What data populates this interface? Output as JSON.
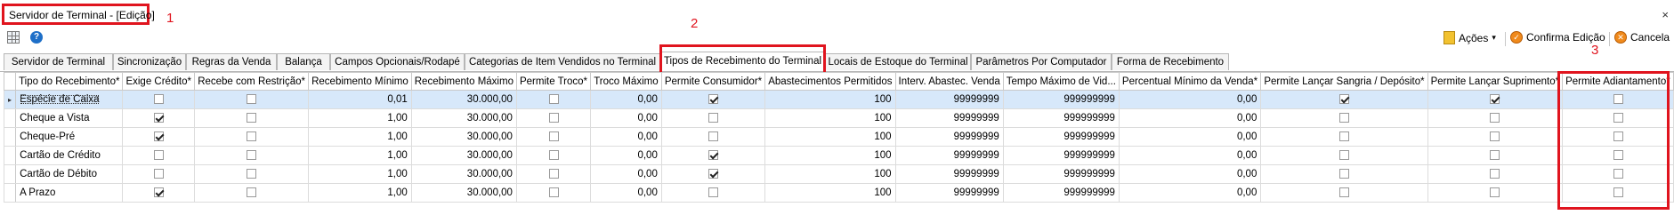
{
  "window": {
    "title": "Servidor de Terminal - [Edição]",
    "close": "×"
  },
  "annotations": [
    "1",
    "2",
    "3"
  ],
  "toolbar": {
    "acoes_label": "Ações",
    "acoes_arrow": "▾",
    "confirm_label": "Confirma Edição",
    "cancel_label": "Cancela",
    "help_glyph": "?"
  },
  "tabs": [
    {
      "label": "Servidor de Terminal"
    },
    {
      "label": "Sincronização"
    },
    {
      "label": "Regras da Venda"
    },
    {
      "label": "Balança"
    },
    {
      "label": "Campos Opcionais/Rodapé"
    },
    {
      "label": "Categorias de Item Vendidos no Terminal"
    },
    {
      "label": "Tipos de Recebimento do Terminal"
    },
    {
      "label": "Locais de Estoque do Terminal"
    },
    {
      "label": "Parâmetros Por Computador"
    },
    {
      "label": "Forma de Recebimento"
    }
  ],
  "active_tab": 6,
  "grid": {
    "row_indicator": "▸",
    "columns": [
      "Tipo do Recebimento*",
      "Exige Crédito*",
      "Recebe com Restrição*",
      "Recebimento Mínimo",
      "Recebimento Máximo",
      "Permite Troco*",
      "Troco Máximo",
      "Permite Consumidor*",
      "Abastecimentos Permitidos",
      "Interv. Abastec. Venda",
      "Tempo Máximo de Vid...",
      "Percentual Mínimo da Venda*",
      "Permite Lançar Sangria / Depósito*",
      "Permite Lançar Suprimento*",
      "Permite Adiantamento*"
    ],
    "rows": [
      {
        "tipo": "Espécie de Caixa",
        "exige_credito": false,
        "recebe_restricao": false,
        "minimo": "0,01",
        "maximo": "30.000,00",
        "permite_troco": false,
        "troco_maximo": "0,00",
        "permite_consumidor": true,
        "abastecimentos": "100",
        "interv": "99999999",
        "tempo": "999999999",
        "percentual": "0,00",
        "sangria": true,
        "suprimento": true,
        "adiantamento": false
      },
      {
        "tipo": "Cheque a Vista",
        "exige_credito": true,
        "recebe_restricao": false,
        "minimo": "1,00",
        "maximo": "30.000,00",
        "permite_troco": false,
        "troco_maximo": "0,00",
        "permite_consumidor": false,
        "abastecimentos": "100",
        "interv": "99999999",
        "tempo": "999999999",
        "percentual": "0,00",
        "sangria": false,
        "suprimento": false,
        "adiantamento": false
      },
      {
        "tipo": "Cheque-Pré",
        "exige_credito": true,
        "recebe_restricao": false,
        "minimo": "1,00",
        "maximo": "30.000,00",
        "permite_troco": false,
        "troco_maximo": "0,00",
        "permite_consumidor": false,
        "abastecimentos": "100",
        "interv": "99999999",
        "tempo": "999999999",
        "percentual": "0,00",
        "sangria": false,
        "suprimento": false,
        "adiantamento": false
      },
      {
        "tipo": "Cartão de Crédito",
        "exige_credito": false,
        "recebe_restricao": false,
        "minimo": "1,00",
        "maximo": "30.000,00",
        "permite_troco": false,
        "troco_maximo": "0,00",
        "permite_consumidor": true,
        "abastecimentos": "100",
        "interv": "99999999",
        "tempo": "999999999",
        "percentual": "0,00",
        "sangria": false,
        "suprimento": false,
        "adiantamento": false
      },
      {
        "tipo": "Cartão de Débito",
        "exige_credito": false,
        "recebe_restricao": false,
        "minimo": "1,00",
        "maximo": "30.000,00",
        "permite_troco": false,
        "troco_maximo": "0,00",
        "permite_consumidor": true,
        "abastecimentos": "100",
        "interv": "99999999",
        "tempo": "999999999",
        "percentual": "0,00",
        "sangria": false,
        "suprimento": false,
        "adiantamento": false
      },
      {
        "tipo": "A Prazo",
        "exige_credito": true,
        "recebe_restricao": false,
        "minimo": "1,00",
        "maximo": "30.000,00",
        "permite_troco": false,
        "troco_maximo": "0,00",
        "permite_consumidor": false,
        "abastecimentos": "100",
        "interv": "99999999",
        "tempo": "999999999",
        "percentual": "0,00",
        "sangria": false,
        "suprimento": false,
        "adiantamento": false
      }
    ]
  },
  "colors": {
    "highlight": "#e0141e",
    "selected_row": "#d7e8fa"
  }
}
